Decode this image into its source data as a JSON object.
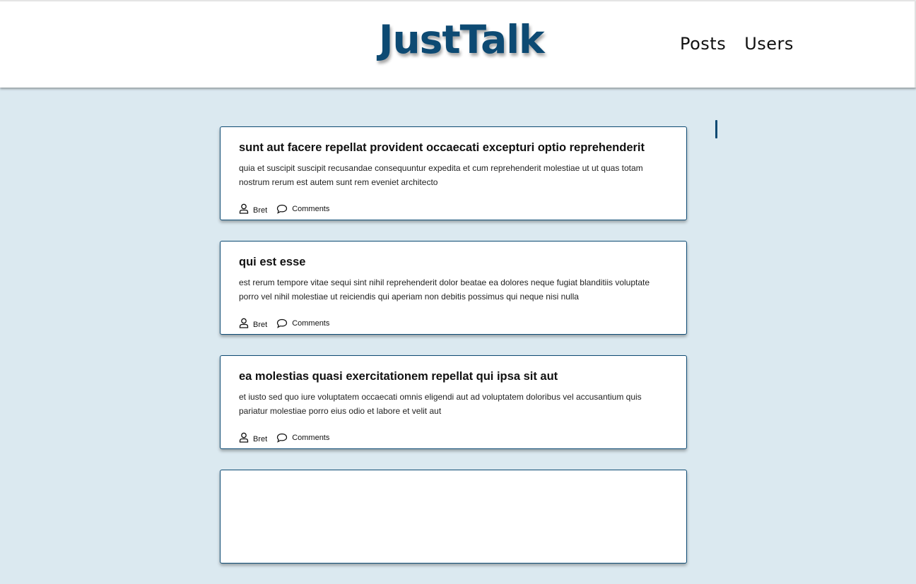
{
  "app": {
    "title": "JustTalk"
  },
  "nav": {
    "items": [
      "Posts",
      "Users"
    ]
  },
  "posts": [
    {
      "title": "sunt aut facere repellat provident occaecati excepturi optio reprehenderit",
      "body": "quia et suscipit suscipit recusandae consequuntur expedita et cum reprehenderit molestiae ut ut quas totam nostrum rerum est autem sunt rem eveniet architecto",
      "author": "Bret",
      "comments_label": "Comments"
    },
    {
      "title": "qui est esse",
      "body": "est rerum tempore vitae sequi sint nihil reprehenderit dolor beatae ea dolores neque fugiat blanditiis voluptate porro vel nihil molestiae ut reiciendis qui aperiam non debitis possimus qui neque nisi nulla",
      "author": "Bret",
      "comments_label": "Comments"
    },
    {
      "title": "ea molestias quasi exercitationem repellat qui ipsa sit aut",
      "body": "et iusto sed quo iure voluptatem occaecati omnis eligendi aut ad voluptatem doloribus vel accusantium quis pariatur molestiae porro eius odio et labore et velit aut",
      "author": "Bret",
      "comments_label": "Comments"
    },
    {
      "title": "",
      "body": "",
      "author": "",
      "comments_label": ""
    }
  ],
  "colors": {
    "brand": "#0d4a73",
    "background": "#dbe9f0",
    "card": "#ffffff"
  },
  "icons": {
    "author": "user-icon",
    "comments": "speech-bubble-icon"
  }
}
